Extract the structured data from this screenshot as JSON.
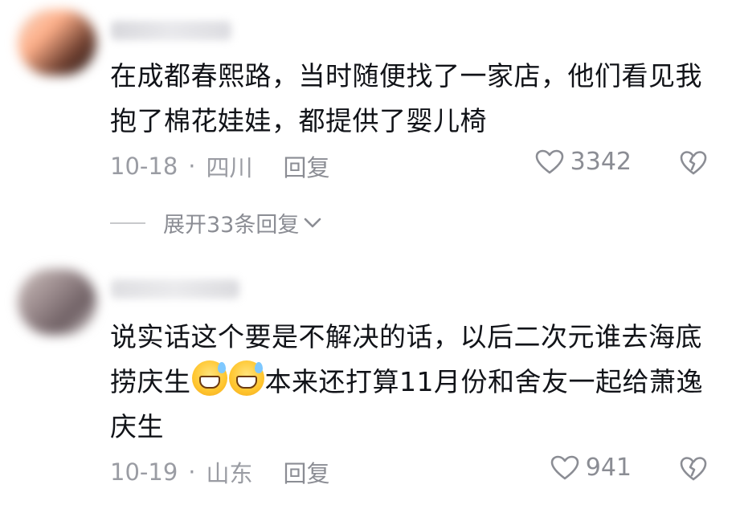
{
  "comments": [
    {
      "text": "在成都春熙路，当时随便找了一家店，他们看见我抱了棉花娃娃，都提供了婴儿椅",
      "date": "10-18",
      "location": "四川",
      "reply_label": "回复",
      "likes": "3342",
      "icons": {
        "like": "heart-outline-icon",
        "dislike": "broken-heart-icon"
      },
      "expand_label": "展开33条回复"
    },
    {
      "text_parts": [
        "说实话这个要是不解决的话，以后二次元谁去海底捞庆生",
        "本来还打算11月份和舍友一起给萧逸庆生"
      ],
      "emoji": "grinning-sweat-emoji",
      "date": "10-19",
      "location": "山东",
      "reply_label": "回复",
      "likes": "941",
      "icons": {
        "like": "heart-outline-icon",
        "dislike": "broken-heart-icon"
      }
    }
  ],
  "separator": "·"
}
